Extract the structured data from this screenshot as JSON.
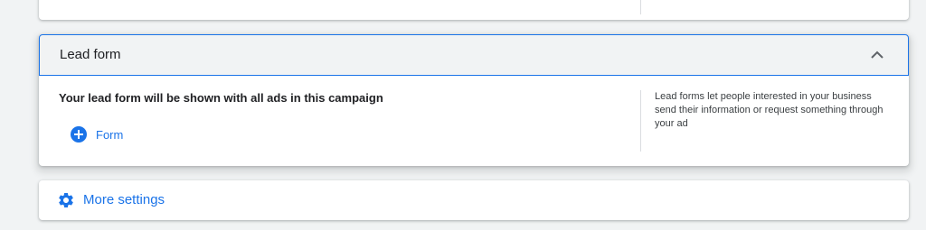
{
  "lead_form": {
    "title": "Lead form",
    "description": "Your lead form will be shown with all ads in this campaign",
    "add_form_label": "Form",
    "help_text": "Lead forms let people interested in your business send their information or request something through your ad"
  },
  "more_settings": {
    "label": "More settings"
  },
  "icons": {
    "collapse": "chevron-up-icon",
    "add": "add-circle-icon",
    "settings": "gear-icon"
  },
  "colors": {
    "accent": "#1a73e8",
    "background": "#f1f3f4",
    "card": "#ffffff"
  }
}
